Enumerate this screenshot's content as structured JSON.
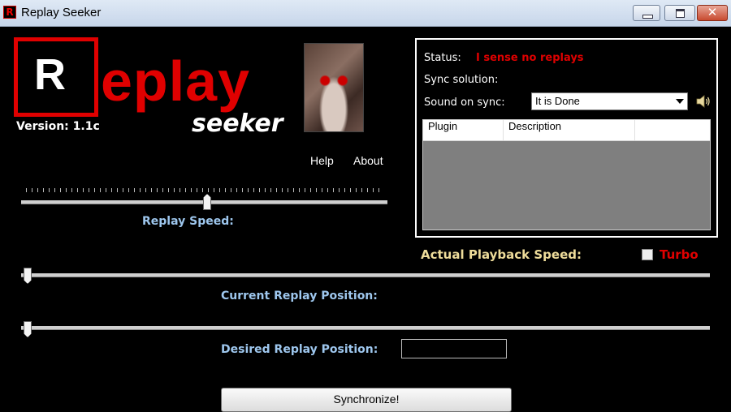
{
  "window": {
    "title": "Replay Seeker",
    "app_icon_letter": "R"
  },
  "logo": {
    "r_letter": "R",
    "rest": "eplay",
    "subtitle": "seeker",
    "version": "Version: 1.1c"
  },
  "menu": {
    "help": "Help",
    "about": "About"
  },
  "replay_speed": {
    "label": "Replay Speed:",
    "value_fraction": 0.5
  },
  "status": {
    "status_label": "Status:",
    "status_value": "I sense no replays",
    "sync_solution_label": "Sync solution:",
    "sound_label": "Sound on sync:",
    "sound_selected": "It is Done"
  },
  "plugins_table": {
    "columns": [
      "Plugin",
      "Description",
      ""
    ]
  },
  "playback": {
    "actual_label": "Actual Playback Speed:",
    "turbo_label": "Turbo",
    "turbo_checked": false
  },
  "current_position": {
    "label": "Current Replay Position:",
    "value_fraction": 0
  },
  "desired_position": {
    "label": "Desired Replay Position:",
    "input_value": ""
  },
  "sync_button": "Synchronize!",
  "colors": {
    "accent_red": "#e00000",
    "label_blue": "#9ec7ee",
    "label_gold": "#eedc9a"
  }
}
